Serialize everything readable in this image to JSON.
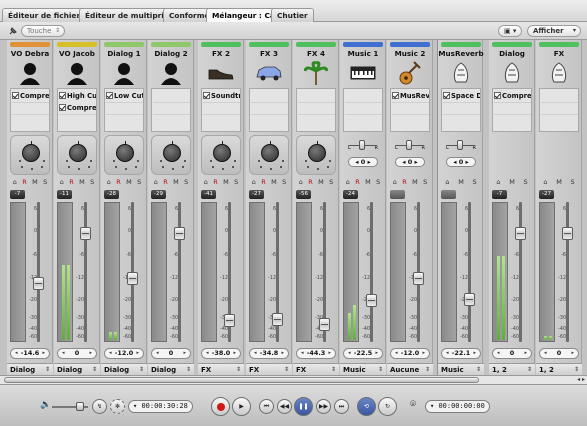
{
  "tabs": [
    {
      "label": "Éditeur de fichiers",
      "active": false
    },
    {
      "label": "Éditeur de multiprises",
      "active": false
    },
    {
      "label": "Conformer",
      "active": false
    },
    {
      "label": "Mélangeur : Cafe",
      "active": true
    },
    {
      "label": "Chutier",
      "active": false
    }
  ],
  "toolbar": {
    "touch_mode": "Touche",
    "afficher_label": "Afficher"
  },
  "strips": [
    {
      "name": "VO Debra",
      "color": "#e0923a",
      "icon": "person-icon",
      "fx": [
        "Compres",
        "",
        ""
      ],
      "vol_label": "-7",
      "value": "-14.6",
      "output": "Dialog",
      "rms": "ready R M S",
      "meter": [
        0,
        0
      ],
      "pan": "knob"
    },
    {
      "name": "VO Jacob",
      "color": "#d7bf2a",
      "icon": "person-icon",
      "fx": [
        "High Cut",
        "Compres",
        ""
      ],
      "vol_label": "-11",
      "value": "0",
      "output": "Dialog",
      "rms": "ready R M S",
      "meter": [
        0.55,
        0.55
      ],
      "pan": "knob"
    },
    {
      "name": "Dialog 1",
      "color": "#8fc86b",
      "icon": "person-icon",
      "fx": [
        "Low Cut",
        "",
        ""
      ],
      "vol_label": "-28",
      "value": "-12.0",
      "output": "Dialog",
      "rms": "ready R M S",
      "meter": [
        0.06,
        0.06
      ],
      "pan": "knob"
    },
    {
      "name": "Dialog 2",
      "color": "#8fc86b",
      "icon": "person-icon",
      "fx": [
        "",
        "",
        ""
      ],
      "vol_label": "-29",
      "value": "0",
      "output": "Dialog",
      "rms": "ready R M S",
      "meter": [
        0,
        0
      ],
      "pan": "knob"
    },
    {
      "name": "FX 2",
      "color": "#4fbf5f",
      "icon": "shoe-icon",
      "fx": [
        "Soundtra",
        "",
        ""
      ],
      "vol_label": "-41",
      "value": "-38.0",
      "output": "FX",
      "rms": "ready R M S",
      "meter": [
        0,
        0
      ],
      "pan": "knob"
    },
    {
      "name": "FX 3",
      "color": "#4fbf5f",
      "icon": "car-icon",
      "fx": [
        "",
        "",
        ""
      ],
      "vol_label": "-27",
      "value": "-34.8",
      "output": "FX",
      "rms": "ready R M S",
      "meter": [
        0,
        0
      ],
      "pan": "knob"
    },
    {
      "name": "FX 4",
      "color": "#4fbf5f",
      "icon": "palm-tree-icon",
      "fx": [
        "",
        "",
        ""
      ],
      "vol_label": "-56",
      "value": "-44.3",
      "output": "FX",
      "rms": "ready R M S",
      "meter": [
        0,
        0
      ],
      "pan": "knob"
    },
    {
      "name": "Music 1",
      "color": "#3f6fd0",
      "icon": "keyboard-icon",
      "fx": [
        "",
        "",
        ""
      ],
      "vol_label": "-24",
      "value": "-22.5",
      "output": "Music",
      "rms": "ready R M S",
      "meter": [
        0.2,
        0.26
      ],
      "pan": "balance",
      "pan_value": "0"
    },
    {
      "name": "Music 2",
      "color": "#3f6fd0",
      "icon": "guitar-icon",
      "fx": [
        "MusReve",
        "",
        ""
      ],
      "vol_label": "",
      "value": "-12.0",
      "output": "Aucune",
      "rms": "ready R M S",
      "meter": [
        0,
        0
      ],
      "pan": "balance",
      "pan_value": "0"
    },
    {
      "name": "MusReverb",
      "color": "#4fbf5f",
      "icon": "bus-icon",
      "fx": [
        "Space De",
        "",
        ""
      ],
      "vol_label": "",
      "value": "-22.1",
      "output": "Music",
      "rms": "ready M S",
      "meter": [
        0,
        0
      ],
      "pan": "balance",
      "pan_value": "0"
    },
    {
      "name": "Dialog",
      "color": "#4fbf5f",
      "icon": "bus-icon",
      "fx": [
        "Compres",
        "",
        ""
      ],
      "vol_label": "-7",
      "value": "0",
      "output": "1, 2",
      "rms": "ready M S",
      "meter": [
        0.62,
        0.62
      ],
      "pan": "none"
    },
    {
      "name": "FX",
      "color": "#4fbf5f",
      "icon": "bus-icon",
      "fx": [
        "",
        "",
        ""
      ],
      "vol_label": "-27",
      "value": "0",
      "output": "1, 2",
      "rms": "ready M S",
      "meter": [
        0.03,
        0.03
      ],
      "pan": "none"
    }
  ],
  "transport": {
    "timecode": "00:00:30:28",
    "timecode2": "00:00:00:00"
  },
  "colors": {
    "background": "#c2c2c2",
    "record": "#d01818"
  }
}
